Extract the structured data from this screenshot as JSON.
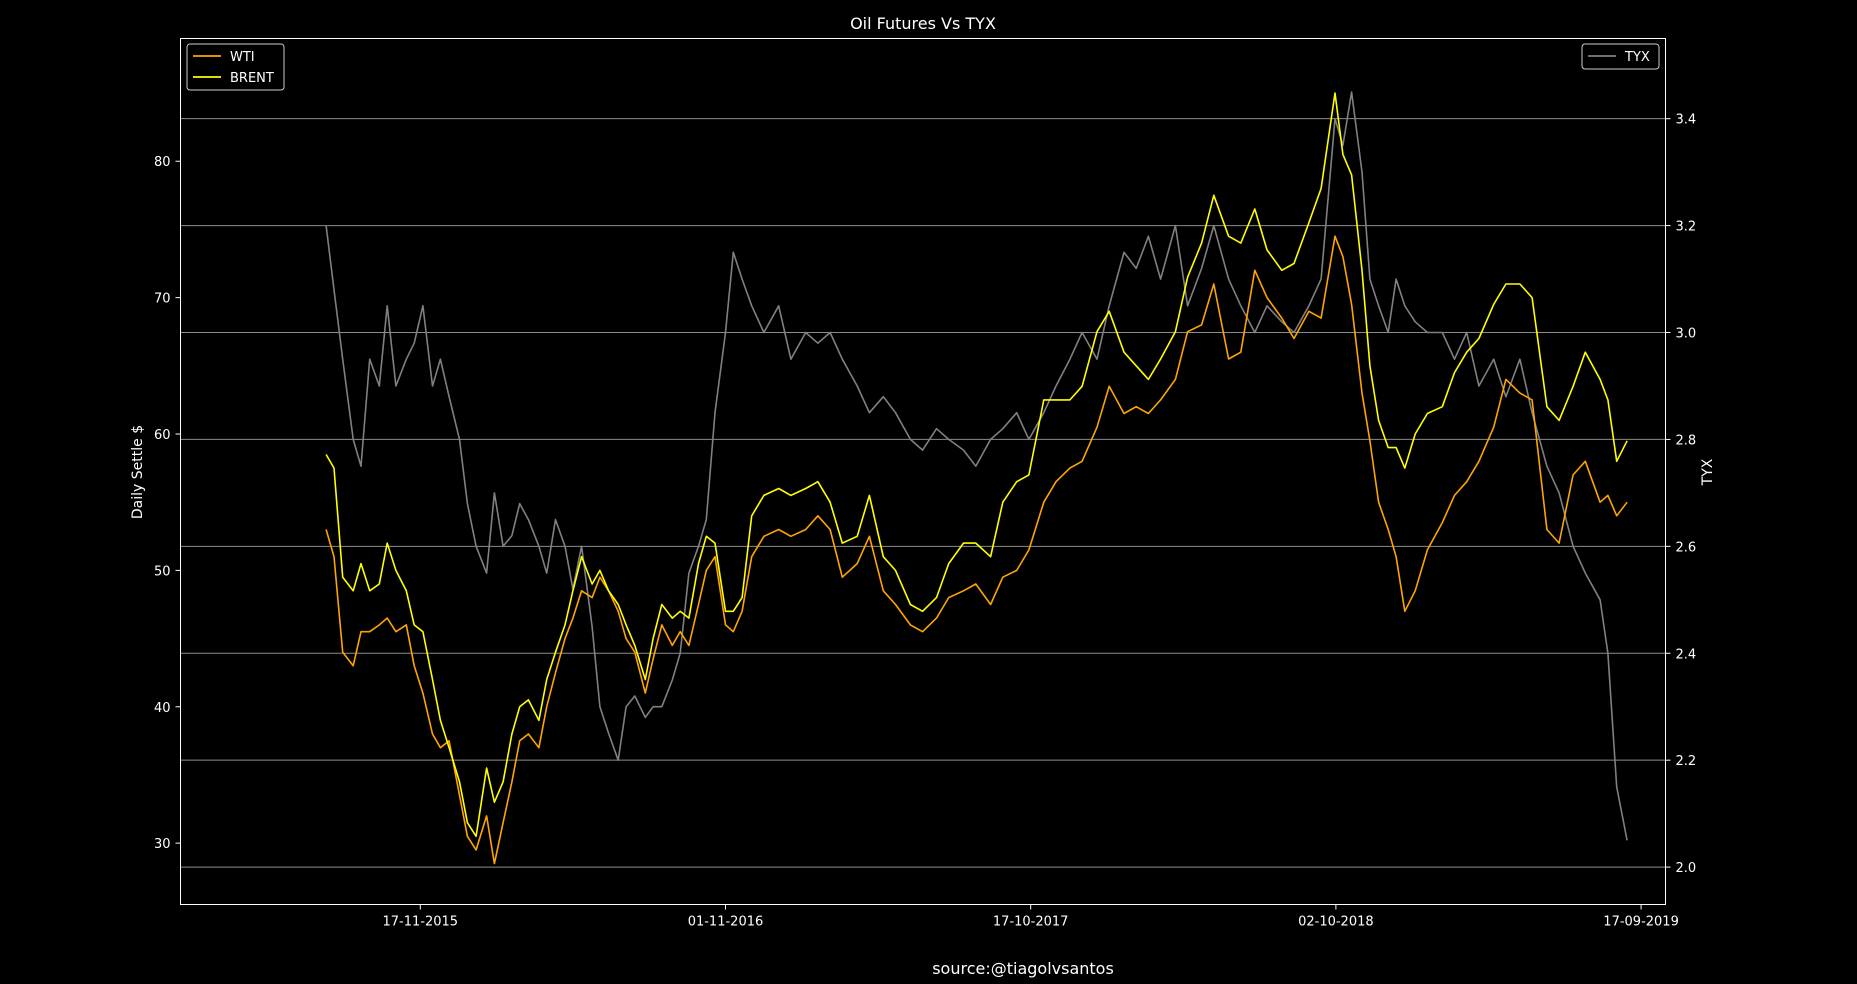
{
  "chart_data": {
    "type": "line",
    "title": "Oil Futures Vs TYX",
    "source": "source:@tiagolvsantos",
    "grid": "horizontal lines on right axis",
    "y_left": {
      "label": "Daily Settle $",
      "lim": [
        25.5,
        89
      ],
      "ticks": [
        30,
        40,
        50,
        60,
        70,
        80
      ],
      "tick_labels": [
        "30",
        "40",
        "50",
        "60",
        "70",
        "80"
      ]
    },
    "y_right": {
      "label": "TYX",
      "lim": [
        1.93,
        3.55
      ],
      "ticks": [
        2.0,
        2.2,
        2.4,
        2.6,
        2.8,
        3.0,
        3.2,
        3.4
      ],
      "tick_labels": [
        "2.0",
        "2.2",
        "2.4",
        "2.6",
        "2.8",
        "3.0",
        "3.2",
        "3.4"
      ]
    },
    "x_axis": {
      "lim": [
        "2015-02-15",
        "2019-10-15"
      ],
      "ticks": [
        "2015-11-17",
        "2016-11-01",
        "2017-10-17",
        "2018-10-02",
        "2019-09-17"
      ],
      "tick_labels": [
        "17-11-2015",
        "01-11-2016",
        "17-10-2017",
        "02-10-2018",
        "17-09-2019"
      ]
    },
    "legend_left": {
      "placement": "upper-left",
      "entries": [
        "WTI",
        "BRENT"
      ]
    },
    "legend_right": {
      "placement": "upper-right",
      "entries": [
        "TYX"
      ]
    },
    "colors": {
      "WTI": "#ffa500",
      "BRENT": "#ffff00",
      "TYX": "#808080",
      "grid": "#8c8c8c",
      "frame": "#ffffff"
    },
    "series": [
      {
        "name": "WTI",
        "axis": "left",
        "color": "#ffa500",
        "x": [
          "2015-08-01",
          "2015-08-10",
          "2015-08-20",
          "2015-09-01",
          "2015-09-10",
          "2015-09-20",
          "2015-10-01",
          "2015-10-10",
          "2015-10-20",
          "2015-11-01",
          "2015-11-10",
          "2015-11-20",
          "2015-12-01",
          "2015-12-10",
          "2015-12-20",
          "2016-01-01",
          "2016-01-10",
          "2016-01-20",
          "2016-02-01",
          "2016-02-10",
          "2016-02-20",
          "2016-03-01",
          "2016-03-10",
          "2016-03-20",
          "2016-04-01",
          "2016-04-10",
          "2016-04-20",
          "2016-05-01",
          "2016-05-10",
          "2016-05-20",
          "2016-06-01",
          "2016-06-10",
          "2016-06-20",
          "2016-07-01",
          "2016-07-10",
          "2016-07-20",
          "2016-08-01",
          "2016-08-10",
          "2016-08-20",
          "2016-09-01",
          "2016-09-10",
          "2016-09-20",
          "2016-10-01",
          "2016-10-10",
          "2016-10-20",
          "2016-11-01",
          "2016-11-10",
          "2016-11-20",
          "2016-12-01",
          "2016-12-15",
          "2017-01-01",
          "2017-01-15",
          "2017-02-01",
          "2017-02-15",
          "2017-03-01",
          "2017-03-15",
          "2017-04-01",
          "2017-04-15",
          "2017-05-01",
          "2017-05-15",
          "2017-06-01",
          "2017-06-15",
          "2017-07-01",
          "2017-07-15",
          "2017-08-01",
          "2017-08-15",
          "2017-09-01",
          "2017-09-15",
          "2017-10-01",
          "2017-10-15",
          "2017-11-01",
          "2017-11-15",
          "2017-12-01",
          "2017-12-15",
          "2018-01-01",
          "2018-01-15",
          "2018-02-01",
          "2018-02-15",
          "2018-03-01",
          "2018-03-15",
          "2018-04-01",
          "2018-04-15",
          "2018-05-01",
          "2018-05-15",
          "2018-06-01",
          "2018-06-15",
          "2018-07-01",
          "2018-07-15",
          "2018-08-01",
          "2018-08-15",
          "2018-09-01",
          "2018-09-15",
          "2018-10-01",
          "2018-10-10",
          "2018-10-20",
          "2018-11-01",
          "2018-11-10",
          "2018-11-20",
          "2018-12-01",
          "2018-12-10",
          "2018-12-20",
          "2019-01-01",
          "2019-01-15",
          "2019-02-01",
          "2019-02-15",
          "2019-03-01",
          "2019-03-15",
          "2019-04-01",
          "2019-04-15",
          "2019-05-01",
          "2019-05-15",
          "2019-06-01",
          "2019-06-15",
          "2019-07-01",
          "2019-07-15",
          "2019-08-01",
          "2019-08-10",
          "2019-08-20",
          "2019-09-01"
        ],
        "values": [
          53.0,
          51.0,
          44.0,
          43.0,
          45.5,
          45.5,
          46.0,
          46.5,
          45.5,
          46.0,
          43.0,
          41.0,
          38.0,
          37.0,
          37.5,
          33.5,
          30.5,
          29.5,
          32.0,
          28.5,
          31.5,
          34.5,
          37.5,
          38.0,
          37.0,
          40.0,
          42.5,
          45.0,
          46.5,
          48.5,
          48.0,
          49.5,
          48.5,
          47.0,
          45.0,
          44.0,
          41.0,
          43.5,
          46.0,
          44.5,
          45.5,
          44.5,
          47.5,
          50.0,
          51.0,
          46.0,
          45.5,
          47.0,
          51.0,
          52.5,
          53.0,
          52.5,
          53.0,
          54.0,
          53.0,
          49.5,
          50.5,
          52.5,
          48.5,
          47.5,
          46.0,
          45.5,
          46.5,
          48.0,
          48.5,
          49.0,
          47.5,
          49.5,
          50.0,
          51.5,
          55.0,
          56.5,
          57.5,
          58.0,
          60.5,
          63.5,
          61.5,
          62.0,
          61.5,
          62.5,
          64.0,
          67.5,
          68.0,
          71.0,
          65.5,
          66.0,
          72.0,
          70.0,
          68.5,
          67.0,
          69.0,
          68.5,
          74.5,
          73.0,
          69.5,
          63.0,
          59.5,
          55.0,
          53.0,
          51.0,
          47.0,
          48.5,
          51.5,
          53.5,
          55.5,
          56.5,
          58.0,
          60.5,
          64.0,
          63.0,
          62.5,
          53.0,
          52.0,
          57.0,
          58.0,
          55.0,
          55.5,
          54.0,
          55.0
        ]
      },
      {
        "name": "BRENT",
        "axis": "left",
        "color": "#ffff00",
        "x": [
          "2015-08-01",
          "2015-08-10",
          "2015-08-20",
          "2015-09-01",
          "2015-09-10",
          "2015-09-20",
          "2015-10-01",
          "2015-10-10",
          "2015-10-20",
          "2015-11-01",
          "2015-11-10",
          "2015-11-20",
          "2015-12-01",
          "2015-12-10",
          "2015-12-20",
          "2016-01-01",
          "2016-01-10",
          "2016-01-20",
          "2016-02-01",
          "2016-02-10",
          "2016-02-20",
          "2016-03-01",
          "2016-03-10",
          "2016-03-20",
          "2016-04-01",
          "2016-04-10",
          "2016-04-20",
          "2016-05-01",
          "2016-05-10",
          "2016-05-20",
          "2016-06-01",
          "2016-06-10",
          "2016-06-20",
          "2016-07-01",
          "2016-07-10",
          "2016-07-20",
          "2016-08-01",
          "2016-08-10",
          "2016-08-20",
          "2016-09-01",
          "2016-09-10",
          "2016-09-20",
          "2016-10-01",
          "2016-10-10",
          "2016-10-20",
          "2016-11-01",
          "2016-11-10",
          "2016-11-20",
          "2016-12-01",
          "2016-12-15",
          "2017-01-01",
          "2017-01-15",
          "2017-02-01",
          "2017-02-15",
          "2017-03-01",
          "2017-03-15",
          "2017-04-01",
          "2017-04-15",
          "2017-05-01",
          "2017-05-15",
          "2017-06-01",
          "2017-06-15",
          "2017-07-01",
          "2017-07-15",
          "2017-08-01",
          "2017-08-15",
          "2017-09-01",
          "2017-09-15",
          "2017-10-01",
          "2017-10-15",
          "2017-11-01",
          "2017-11-15",
          "2017-12-01",
          "2017-12-15",
          "2018-01-01",
          "2018-01-15",
          "2018-02-01",
          "2018-02-15",
          "2018-03-01",
          "2018-03-15",
          "2018-04-01",
          "2018-04-15",
          "2018-05-01",
          "2018-05-15",
          "2018-06-01",
          "2018-06-15",
          "2018-07-01",
          "2018-07-15",
          "2018-08-01",
          "2018-08-15",
          "2018-09-01",
          "2018-09-15",
          "2018-10-01",
          "2018-10-10",
          "2018-10-20",
          "2018-11-01",
          "2018-11-10",
          "2018-11-20",
          "2018-12-01",
          "2018-12-10",
          "2018-12-20",
          "2019-01-01",
          "2019-01-15",
          "2019-02-01",
          "2019-02-15",
          "2019-03-01",
          "2019-03-15",
          "2019-04-01",
          "2019-04-15",
          "2019-05-01",
          "2019-05-15",
          "2019-06-01",
          "2019-06-15",
          "2019-07-01",
          "2019-07-15",
          "2019-08-01",
          "2019-08-10",
          "2019-08-20",
          "2019-09-01"
        ],
        "values": [
          58.5,
          57.5,
          49.5,
          48.5,
          50.5,
          48.5,
          49.0,
          52.0,
          50.0,
          48.5,
          46.0,
          45.5,
          42.0,
          39.0,
          37.0,
          34.5,
          31.5,
          30.5,
          35.5,
          33.0,
          34.5,
          38.0,
          40.0,
          40.5,
          39.0,
          42.0,
          44.0,
          46.0,
          48.5,
          51.0,
          49.0,
          50.0,
          48.5,
          47.5,
          46.0,
          44.5,
          42.0,
          45.0,
          47.5,
          46.5,
          47.0,
          46.5,
          50.5,
          52.5,
          52.0,
          47.0,
          47.0,
          48.0,
          54.0,
          55.5,
          56.0,
          55.5,
          56.0,
          56.5,
          55.0,
          52.0,
          52.5,
          55.5,
          51.0,
          50.0,
          47.5,
          47.0,
          48.0,
          50.5,
          52.0,
          52.0,
          51.0,
          55.0,
          56.5,
          57.0,
          62.5,
          62.5,
          62.5,
          63.5,
          67.5,
          69.0,
          66.0,
          65.0,
          64.0,
          65.5,
          67.5,
          71.5,
          74.0,
          77.5,
          74.5,
          74.0,
          76.5,
          73.5,
          72.0,
          72.5,
          75.5,
          78.0,
          85.0,
          80.5,
          79.0,
          72.0,
          65.0,
          61.0,
          59.0,
          59.0,
          57.5,
          60.0,
          61.5,
          62.0,
          64.5,
          66.0,
          67.0,
          69.5,
          71.0,
          71.0,
          70.0,
          62.0,
          61.0,
          63.5,
          66.0,
          64.0,
          62.5,
          58.0,
          59.5
        ]
      },
      {
        "name": "TYX",
        "axis": "right",
        "color": "#808080",
        "x": [
          "2015-08-01",
          "2015-08-10",
          "2015-08-20",
          "2015-09-01",
          "2015-09-10",
          "2015-09-20",
          "2015-10-01",
          "2015-10-10",
          "2015-10-20",
          "2015-11-01",
          "2015-11-10",
          "2015-11-20",
          "2015-12-01",
          "2015-12-10",
          "2015-12-20",
          "2016-01-01",
          "2016-01-10",
          "2016-01-20",
          "2016-02-01",
          "2016-02-10",
          "2016-02-20",
          "2016-03-01",
          "2016-03-10",
          "2016-03-20",
          "2016-04-01",
          "2016-04-10",
          "2016-04-20",
          "2016-05-01",
          "2016-05-10",
          "2016-05-20",
          "2016-06-01",
          "2016-06-10",
          "2016-06-20",
          "2016-07-01",
          "2016-07-10",
          "2016-07-20",
          "2016-08-01",
          "2016-08-10",
          "2016-08-20",
          "2016-09-01",
          "2016-09-10",
          "2016-09-20",
          "2016-10-01",
          "2016-10-10",
          "2016-10-20",
          "2016-11-01",
          "2016-11-10",
          "2016-11-20",
          "2016-12-01",
          "2016-12-15",
          "2017-01-01",
          "2017-01-15",
          "2017-02-01",
          "2017-02-15",
          "2017-03-01",
          "2017-03-15",
          "2017-04-01",
          "2017-04-15",
          "2017-05-01",
          "2017-05-15",
          "2017-06-01",
          "2017-06-15",
          "2017-07-01",
          "2017-07-15",
          "2017-08-01",
          "2017-08-15",
          "2017-09-01",
          "2017-09-15",
          "2017-10-01",
          "2017-10-15",
          "2017-11-01",
          "2017-11-15",
          "2017-12-01",
          "2017-12-15",
          "2018-01-01",
          "2018-01-15",
          "2018-02-01",
          "2018-02-15",
          "2018-03-01",
          "2018-03-15",
          "2018-04-01",
          "2018-04-15",
          "2018-05-01",
          "2018-05-15",
          "2018-06-01",
          "2018-06-15",
          "2018-07-01",
          "2018-07-15",
          "2018-08-01",
          "2018-08-15",
          "2018-09-01",
          "2018-09-15",
          "2018-10-01",
          "2018-10-10",
          "2018-10-20",
          "2018-11-01",
          "2018-11-10",
          "2018-11-20",
          "2018-12-01",
          "2018-12-10",
          "2018-12-20",
          "2019-01-01",
          "2019-01-15",
          "2019-02-01",
          "2019-02-15",
          "2019-03-01",
          "2019-03-15",
          "2019-04-01",
          "2019-04-15",
          "2019-05-01",
          "2019-05-15",
          "2019-06-01",
          "2019-06-15",
          "2019-07-01",
          "2019-07-15",
          "2019-08-01",
          "2019-08-10",
          "2019-08-20",
          "2019-09-01"
        ],
        "values": [
          3.2,
          3.08,
          2.95,
          2.8,
          2.75,
          2.95,
          2.9,
          3.05,
          2.9,
          2.95,
          2.98,
          3.05,
          2.9,
          2.95,
          2.88,
          2.8,
          2.68,
          2.6,
          2.55,
          2.7,
          2.6,
          2.62,
          2.68,
          2.65,
          2.6,
          2.55,
          2.65,
          2.6,
          2.52,
          2.6,
          2.45,
          2.3,
          2.25,
          2.2,
          2.3,
          2.32,
          2.28,
          2.3,
          2.3,
          2.35,
          2.4,
          2.55,
          2.6,
          2.65,
          2.85,
          3.0,
          3.15,
          3.1,
          3.05,
          3.0,
          3.05,
          2.95,
          3.0,
          2.98,
          3.0,
          2.95,
          2.9,
          2.85,
          2.88,
          2.85,
          2.8,
          2.78,
          2.82,
          2.8,
          2.78,
          2.75,
          2.8,
          2.82,
          2.85,
          2.8,
          2.85,
          2.9,
          2.95,
          3.0,
          2.95,
          3.05,
          3.15,
          3.12,
          3.18,
          3.1,
          3.2,
          3.05,
          3.12,
          3.2,
          3.1,
          3.05,
          3.0,
          3.05,
          3.02,
          3.0,
          3.05,
          3.1,
          3.4,
          3.35,
          3.45,
          3.3,
          3.1,
          3.05,
          3.0,
          3.1,
          3.05,
          3.02,
          3.0,
          3.0,
          2.95,
          3.0,
          2.9,
          2.95,
          2.88,
          2.95,
          2.85,
          2.75,
          2.7,
          2.6,
          2.55,
          2.5,
          2.4,
          2.15,
          2.05
        ]
      }
    ]
  }
}
